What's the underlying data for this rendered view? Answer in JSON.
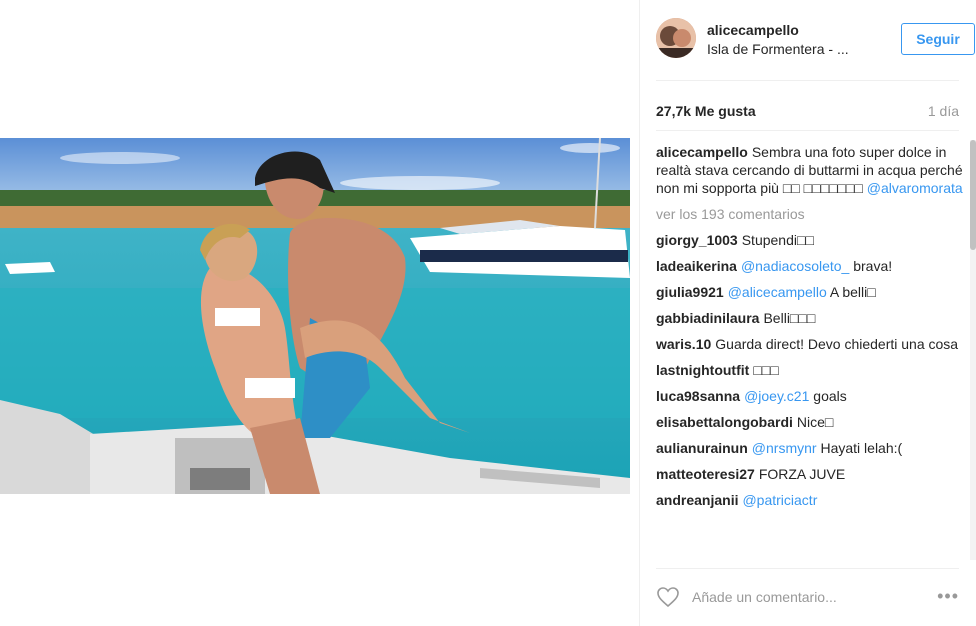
{
  "post": {
    "username": "alicecampello",
    "location": "Isla de Formentera - ...",
    "follow_label": "Seguir",
    "likes": "27,7k Me gusta",
    "time": "1 día"
  },
  "caption": {
    "username": "alicecampello",
    "text": "Sembra una foto super dolce in realtà stava cercando di buttarmi in acqua perché non mi sopporta più □□ □□□□□□□",
    "mention": "@alvaromorata"
  },
  "view_all": "ver los 193 comentarios",
  "comments": [
    {
      "user": "giorgy_1003",
      "text": "Stupendi□□",
      "mention": ""
    },
    {
      "user": "ladeaikerina",
      "text": "brava!",
      "mention": "@nadiacosoleto_"
    },
    {
      "user": "giulia9921",
      "text": "A belli□",
      "mention": "@alicecampello"
    },
    {
      "user": "gabbiadinilaura",
      "text": "Belli□□□",
      "mention": ""
    },
    {
      "user": "waris.10",
      "text": "Guarda direct! Devo chiederti una cosa",
      "mention": ""
    },
    {
      "user": "lastnightoutfit",
      "text": "□□□",
      "mention": ""
    },
    {
      "user": "luca98sanna",
      "text": "goals",
      "mention": "@joey.c21"
    },
    {
      "user": "elisabettalongobardi",
      "text": "Nice□",
      "mention": ""
    },
    {
      "user": "aulianurainun",
      "text": "Hayati lelah:(",
      "mention": "@nrsmynr"
    },
    {
      "user": "matteoteresi27",
      "text": "FORZA JUVE",
      "mention": ""
    },
    {
      "user": "andreanjanii",
      "text": "",
      "mention": "@patriciactr"
    }
  ],
  "add_comment_placeholder": "Añade un comentario...",
  "options_label": "•••",
  "colors": {
    "accent": "#3897f0",
    "muted": "#999999",
    "text": "#262626"
  }
}
